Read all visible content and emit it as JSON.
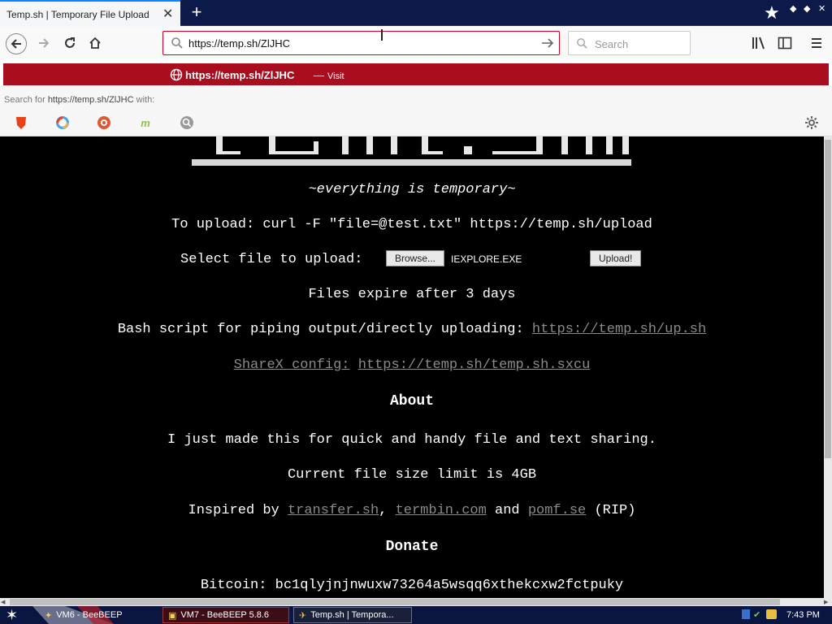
{
  "browser": {
    "tab_title": "Temp.sh | Temporary File Upload",
    "url": "https://temp.sh/ZlJHC",
    "search_placeholder": "Search"
  },
  "suggestion": {
    "visit_url": "https://temp.sh/ZlJHC",
    "visit_sep": "—",
    "visit_action": "Visit",
    "search_for_prefix": "Search for",
    "search_for_url": "https://temp.sh/ZlJHC",
    "search_for_suffix": "with:"
  },
  "page": {
    "tagline": "~everything is temporary~",
    "upload_cmd": "To upload: curl -F \"file=@test.txt\" https://temp.sh/upload",
    "select_label": "Select file to upload:",
    "browse_button": "Browse...",
    "selected_file": "IEXPLORE.EXE",
    "upload_button": "Upload!",
    "expire_text": "Files expire after 3 days",
    "bash_label": "Bash script for piping output/directly uploading:",
    "bash_link": "https://temp.sh/up.sh",
    "sharex_label": "ShareX config:",
    "sharex_link": "https://temp.sh/temp.sh.sxcu",
    "about_heading": "About",
    "about_text": "I just made this for quick and handy file and text sharing.",
    "size_limit": "Current file size limit is 4GB",
    "inspired_prefix": "Inspired by",
    "inspired_links": [
      "transfer.sh",
      "termbin.com",
      "pomf.se"
    ],
    "inspired_comma": ",",
    "inspired_and": "and",
    "inspired_suffix": "(RIP)",
    "donate_heading": "Donate",
    "bitcoin": "Bitcoin: bc1qlyjnjnwuxw73264a5wsqq6xthekcxw2fctpuky"
  },
  "taskbar": {
    "items": [
      "VM6 - BeeBEEP",
      "VM7 - BeeBEEP 5.8.6",
      "Temp.sh | Tempora..."
    ],
    "clock": "7:43 PM"
  },
  "colors": {
    "visit_bar": "#a80e1e",
    "page_bg": "#000000",
    "link": "#8a8a8a"
  }
}
